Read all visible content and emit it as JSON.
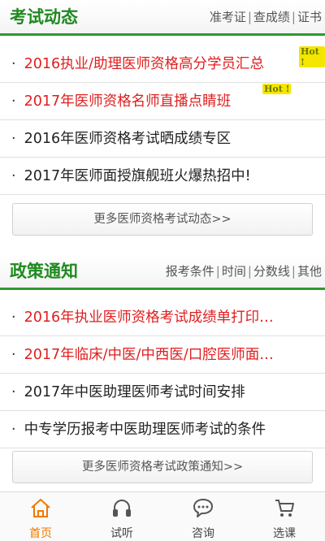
{
  "exam_news": {
    "title": "考试动态",
    "links": [
      "准考证",
      "查成绩",
      "证书"
    ],
    "items": [
      {
        "text": "2016执业/助理医师资格高分学员汇总",
        "highlight": true,
        "badge": "Hot !"
      },
      {
        "text": "2017年医师资格名师直播点睛班",
        "highlight": true,
        "badge": "Hot !"
      },
      {
        "text": "2016年医师资格考试晒成绩专区",
        "highlight": false
      },
      {
        "text": "2017年医师面授旗舰班火爆热招中!",
        "highlight": false
      }
    ],
    "more_label": "更多医师资格考试动态>>"
  },
  "policy": {
    "title": "政策通知",
    "links": [
      "报考条件",
      "时间",
      "分数线",
      "其他"
    ],
    "items": [
      {
        "text": "2016年执业医师资格考试成绩单打印…",
        "highlight": true
      },
      {
        "text": "2017年临床/中医/中西医/口腔医师面…",
        "highlight": true
      },
      {
        "text": "2017年中医助理医师考试时间安排",
        "highlight": false
      },
      {
        "text": "中专学历报考中医助理医师考试的条件",
        "highlight": false
      }
    ],
    "more_label": "更多医师资格考试政策通知>>"
  },
  "colors": {
    "accent_green": "#2f9a2f",
    "highlight_red": "#e01e1e",
    "active_tab": "#f07800"
  },
  "tabbar": {
    "tabs": [
      {
        "label": "首页",
        "icon": "home-icon",
        "active": true
      },
      {
        "label": "试听",
        "icon": "headphones-icon",
        "active": false
      },
      {
        "label": "咨询",
        "icon": "chat-icon",
        "active": false
      },
      {
        "label": "选课",
        "icon": "cart-icon",
        "active": false
      }
    ]
  }
}
